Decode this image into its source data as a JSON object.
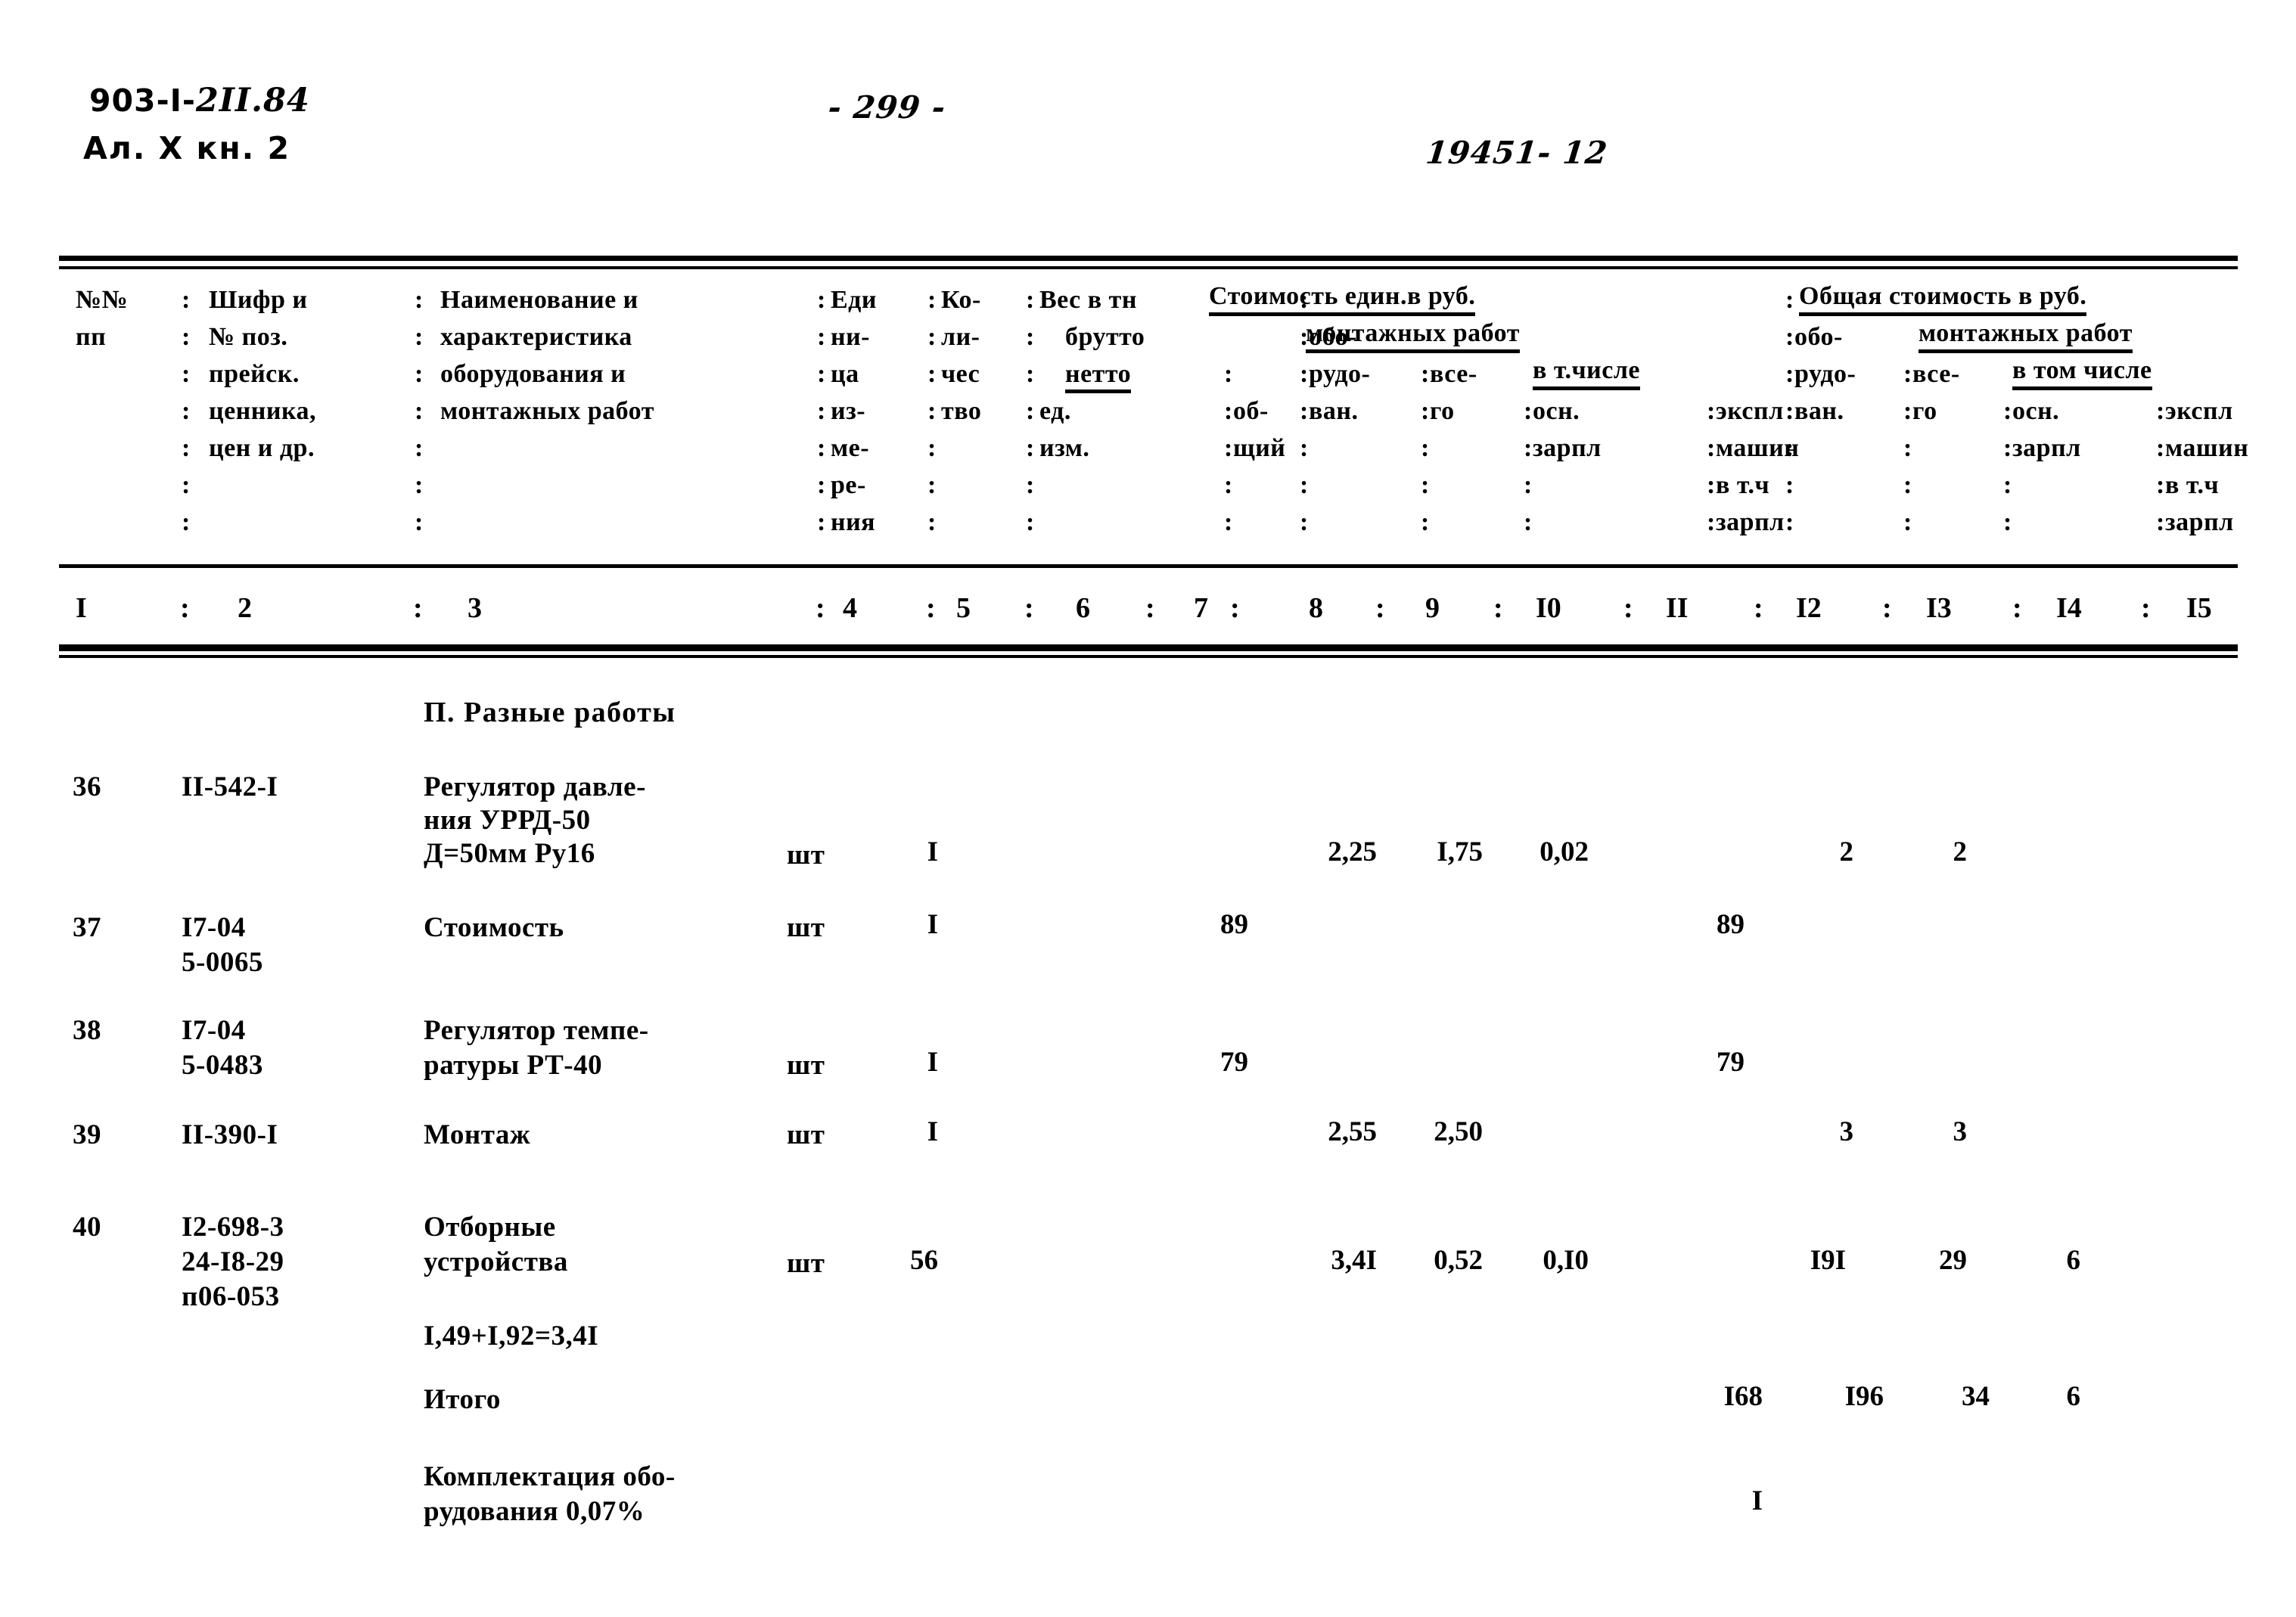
{
  "header": {
    "doc_code_printed": "903-I-",
    "doc_code_hand": "2II.84",
    "doc_sub": "Ал. X  кн. 2",
    "page_number": "- 299 -",
    "order_number": "19451- 12"
  },
  "table": {
    "header_rows": {
      "col1": [
        "№№",
        "пп"
      ],
      "col2": [
        "Шифр и",
        "№ поз.",
        "прейск.",
        "ценника,",
        "цен и др."
      ],
      "col3": [
        "Наименование и",
        "характеристика",
        "оборудования и",
        "монтажных работ"
      ],
      "col4": [
        "Еди",
        "ни-",
        "ца",
        "из-",
        "ме-",
        "ре-",
        "ния"
      ],
      "col5": [
        "Ко-",
        "ли-",
        "чес",
        "тво"
      ],
      "col6_7_group": "Вес в тн",
      "col6": [
        "брутто",
        "нетто",
        "ед.",
        "изм."
      ],
      "col7": [
        "об-",
        "щий"
      ],
      "group_unit_cost": "Стоимость един.в руб.",
      "group_total_cost": "Общая стоимость в руб.",
      "group_mont_1": "монтажных работ",
      "group_mont_2": "монтажных работ",
      "group_vtom_1": "в т.числе",
      "group_vtom_2": "в том числе",
      "col8": [
        "обо-",
        "рудо-",
        "ван."
      ],
      "col9": [
        "все-",
        "го"
      ],
      "col10": [
        "осн.",
        "зарпл"
      ],
      "col11": [
        "экспл",
        "машин",
        "в т.ч",
        "зарпл"
      ],
      "col12": [
        "обо-",
        "рудо-",
        "ван."
      ],
      "col13": [
        "все-",
        "го"
      ],
      "col14": [
        "осн.",
        "зарпл"
      ],
      "col15": [
        "экспл",
        "машин",
        "в т.ч",
        "зарпл"
      ]
    },
    "column_numbers": [
      "I",
      "2",
      "3",
      "4",
      "5",
      "6",
      "7",
      "8",
      "9",
      "I0",
      "II",
      "I2",
      "I3",
      "I4",
      "I5"
    ],
    "section_title": "П. Разные работы",
    "rows": [
      {
        "no": "36",
        "code": [
          "II-542-I"
        ],
        "name": [
          "Регулятор давле-",
          "ния УРРД-50",
          "Д=50мм Ру16"
        ],
        "unit": "шт",
        "qty": "I",
        "c6": "",
        "c7": "",
        "c8": "",
        "c9": "2,25",
        "c10": "I,75",
        "c11": "0,02",
        "c12": "",
        "c13": "2",
        "c14": "2",
        "c15": ""
      },
      {
        "no": "37",
        "code": [
          "I7-04",
          "5-0065"
        ],
        "name": [
          "Стоимость"
        ],
        "unit": "шт",
        "qty": "I",
        "c6": "",
        "c7": "",
        "c8": "89",
        "c9": "",
        "c10": "",
        "c11": "",
        "c12": "89",
        "c13": "",
        "c14": "",
        "c15": ""
      },
      {
        "no": "38",
        "code": [
          "I7-04",
          "5-0483"
        ],
        "name": [
          "Регулятор темпе-",
          "ратуры РТ-40"
        ],
        "unit": "шт",
        "qty": "I",
        "c6": "",
        "c7": "",
        "c8": "79",
        "c9": "",
        "c10": "",
        "c11": "",
        "c12": "79",
        "c13": "",
        "c14": "",
        "c15": ""
      },
      {
        "no": "39",
        "code": [
          "II-390-I"
        ],
        "name": [
          "Монтаж"
        ],
        "unit": "шт",
        "qty": "I",
        "c6": "",
        "c7": "",
        "c8": "",
        "c9": "2,55",
        "c10": "2,50",
        "c11": "",
        "c12": "",
        "c13": "3",
        "c14": "3",
        "c15": ""
      },
      {
        "no": "40",
        "code": [
          "I2-698-3",
          "24-I8-29",
          "п06-053"
        ],
        "name": [
          "Отборные",
          "устройства"
        ],
        "unit": "шт",
        "qty": "56",
        "c6": "",
        "c7": "",
        "c8": "",
        "c9": "3,4I",
        "c10": "0,52",
        "c11": "0,I0",
        "c12": "",
        "c13": "I9I",
        "c14": "29",
        "c15": "6"
      }
    ],
    "note_formula": "I,49+I,92=3,4I",
    "total_label": "Итого",
    "total_values": {
      "c12": "I68",
      "c13": "I96",
      "c14": "34",
      "c15": "6"
    },
    "complect_label": [
      "Комплектация обо-",
      "рудования 0,07%"
    ],
    "complect_value": "I"
  }
}
